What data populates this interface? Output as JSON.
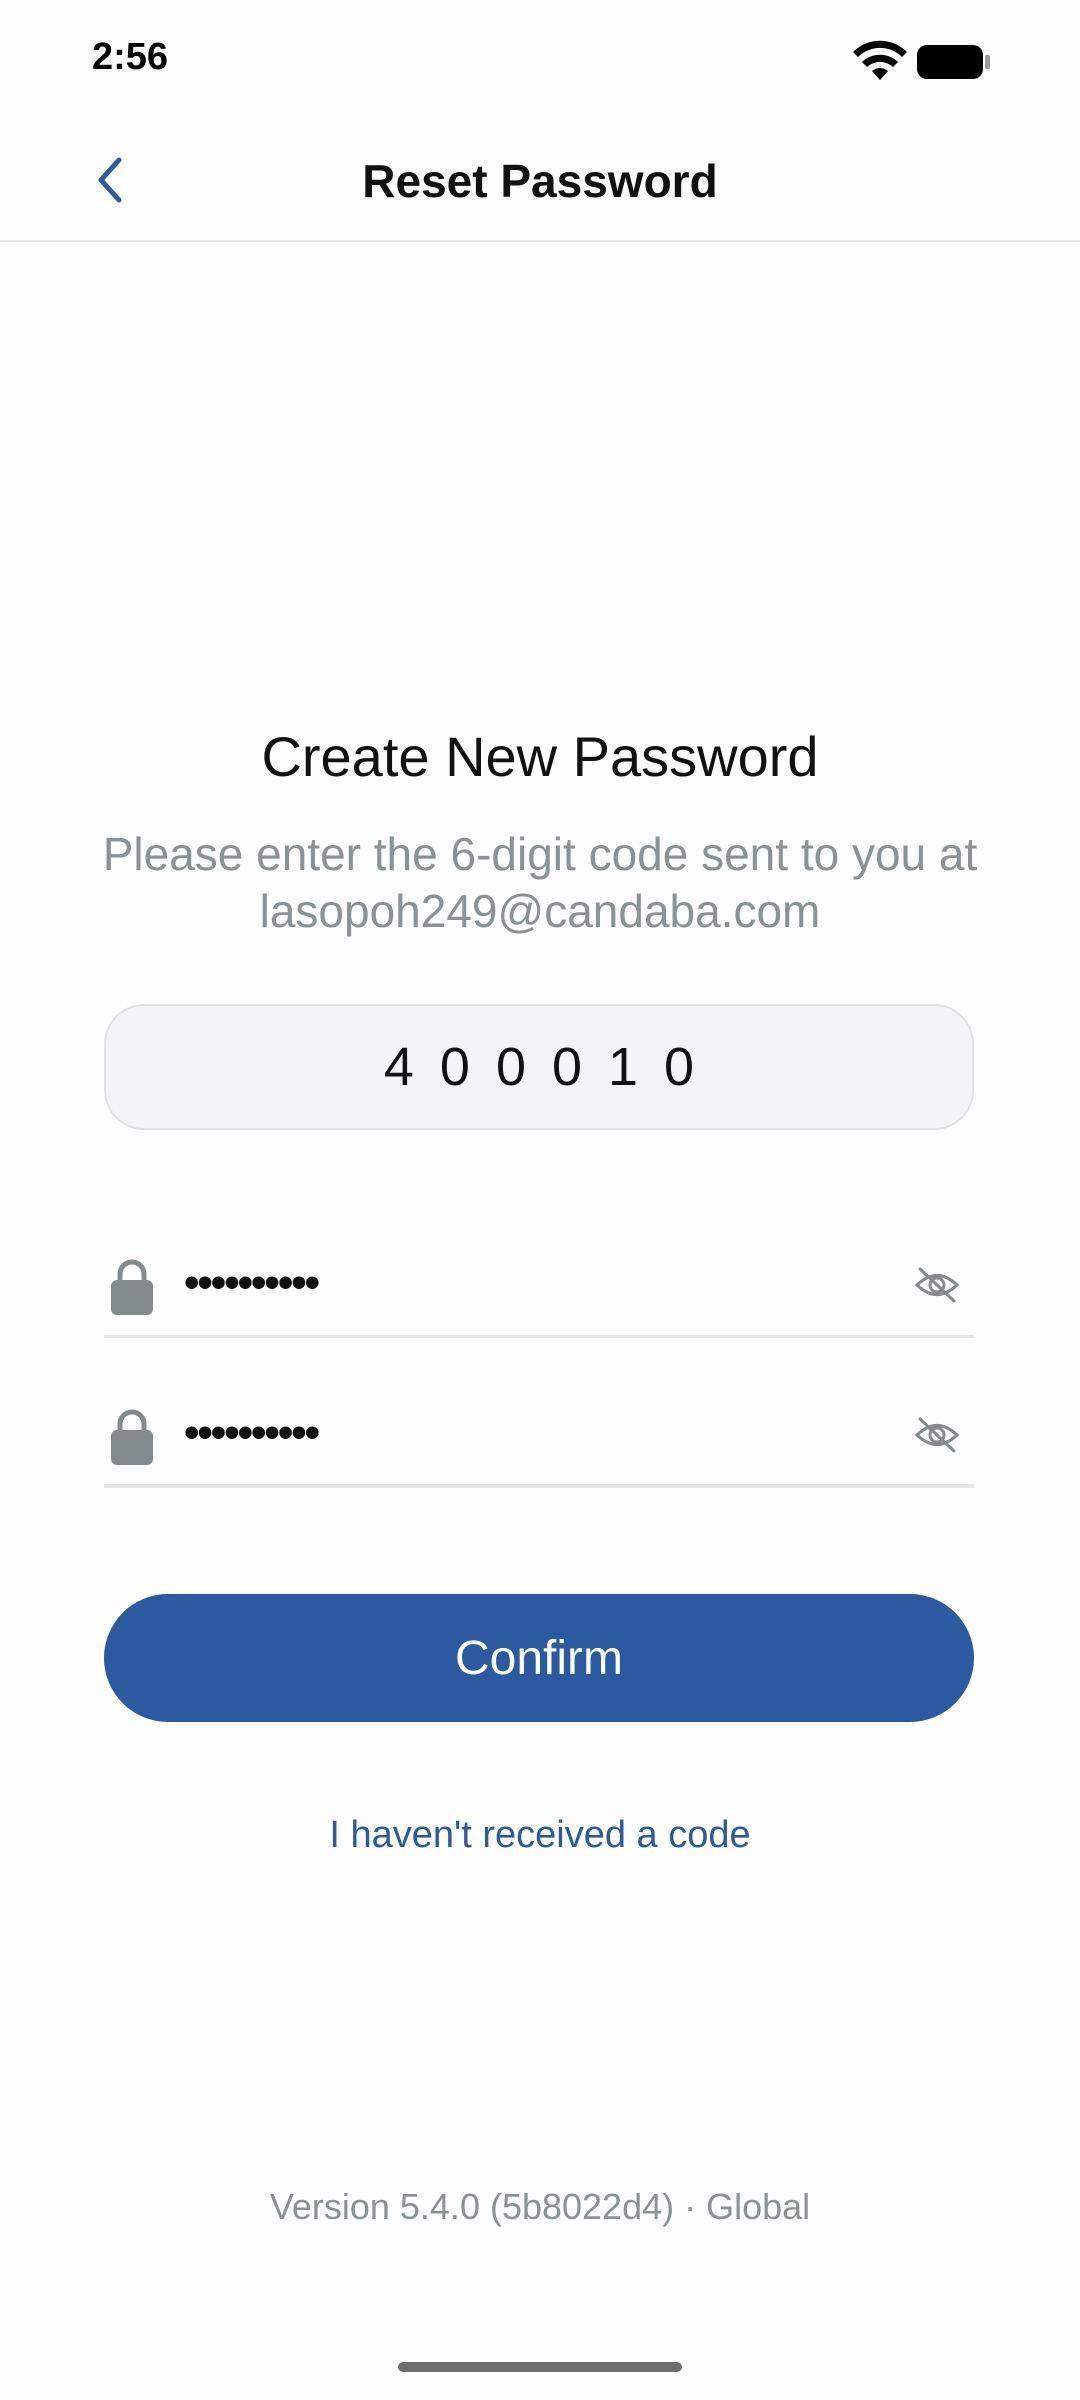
{
  "status_bar": {
    "time": "2:56"
  },
  "header": {
    "title": "Reset Password",
    "back_icon": "chevron-left-icon"
  },
  "main": {
    "heading": "Create New Password",
    "subtext": "Please enter the 6-digit code sent to you at lasopoh249@candaba.com",
    "code_value": "400010",
    "password_field": {
      "value": "••••••••••",
      "lock_icon": "lock-icon",
      "toggle_icon": "eye-off-icon"
    },
    "confirm_password_field": {
      "value": "••••••••••",
      "lock_icon": "lock-icon",
      "toggle_icon": "eye-off-icon"
    },
    "confirm_label": "Confirm",
    "resend_link": "I haven't received a code"
  },
  "footer": {
    "version": "Version 5.4.0 (5b8022d4) · Global"
  },
  "colors": {
    "accent": "#2c5aa0",
    "muted_text": "#8b9296",
    "icon_gray": "#848b8f"
  }
}
